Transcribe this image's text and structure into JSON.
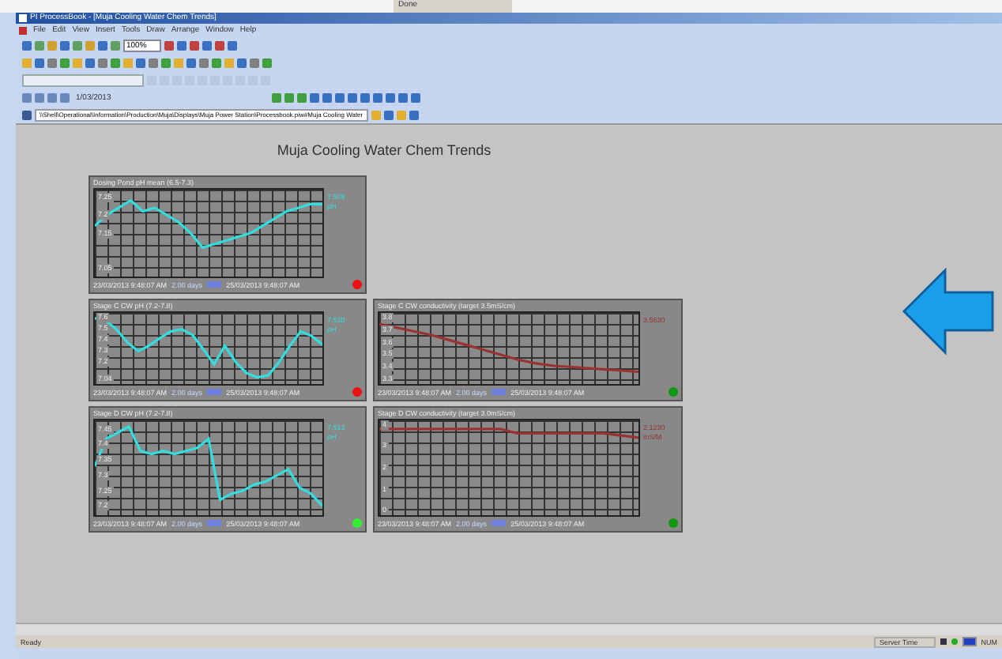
{
  "top_strip": {
    "text": "Done"
  },
  "window": {
    "title": "PI ProcessBook - [Muja Cooling Water Chem Trends]"
  },
  "menu": [
    "File",
    "Edit",
    "View",
    "Insert",
    "Tools",
    "Draw",
    "Arrange",
    "Window",
    "Help"
  ],
  "toolbar": {
    "zoom": "100%",
    "time": "1/03/2013"
  },
  "address": "\\\\Shell\\Operational\\Information\\Production\\Muja\\Displays\\Muja Power Station\\Processbook.piw#Muja Cooling Water",
  "page_title": "Muja Cooling Water Chem Trends",
  "trend_rows": [
    [
      {
        "title": "Dosing Pond pH mean (6.5-7.3)",
        "color": "#ee1111",
        "legend_value": "7.509",
        "legend_unit": "pH",
        "start_time": "23/03/2013 9:48:07 AM",
        "duration": "2.00 days",
        "end_time": "25/03/2013 9:48:07 AM",
        "chart_data": {
          "type": "line",
          "ylim": [
            7.03,
            7.27
          ],
          "yticks": [
            7.05,
            7.15,
            7.2,
            7.25
          ],
          "series": [
            {
              "color": "#33dddd",
              "values": [
                7.17,
                7.2,
                7.22,
                7.24,
                7.21,
                7.22,
                7.2,
                7.18,
                7.15,
                7.11,
                7.12,
                7.13,
                7.14,
                7.15,
                7.17,
                7.19,
                7.21,
                7.22,
                7.23,
                7.23
              ]
            }
          ]
        }
      }
    ],
    [
      {
        "title": "Stage C CW pH (7.2-7.8)",
        "color": "#ee1111",
        "legend_value": "7.530",
        "legend_unit": "pH",
        "start_time": "23/03/2013 9:48:07 AM",
        "duration": "2.00 days",
        "end_time": "25/03/2013 9:48:07 AM",
        "chart_data": {
          "type": "line",
          "ylim": [
            7.0,
            7.65
          ],
          "yticks": [
            7.04,
            7.2,
            7.3,
            7.4,
            7.5,
            7.6
          ],
          "series": [
            {
              "color": "#33dddd",
              "values": [
                7.6,
                7.58,
                7.5,
                7.38,
                7.3,
                7.35,
                7.42,
                7.48,
                7.5,
                7.45,
                7.32,
                7.18,
                7.35,
                7.2,
                7.1,
                7.06,
                7.08,
                7.2,
                7.35,
                7.48,
                7.44,
                7.36
              ]
            }
          ]
        }
      },
      {
        "title": "Stage C CW conductivity (target 3.5mS/cm)",
        "color": "#119911",
        "legend_value": "3.5630",
        "start_time": "23/03/2013 9:48:07 AM",
        "duration": "2.00 days",
        "end_time": "25/03/2013 9:48:07 AM",
        "chart_data": {
          "type": "line",
          "ylim": [
            3.26,
            3.84
          ],
          "yticks": [
            3.3,
            3.4,
            3.5,
            3.6,
            3.7,
            3.8
          ],
          "series": [
            {
              "color": "#993333",
              "values": [
                3.75,
                3.72,
                3.69,
                3.66,
                3.62,
                3.58,
                3.54,
                3.5,
                3.46,
                3.43,
                3.41,
                3.4,
                3.39,
                3.38,
                3.37,
                3.36
              ]
            }
          ]
        }
      }
    ],
    [
      {
        "title": "Stage D CW pH (7.2-7.8)",
        "color": "#33ee33",
        "legend_value": "7.513",
        "legend_unit": "pH",
        "start_time": "23/03/2013 9:48:07 AM",
        "duration": "2.00 days",
        "end_time": "25/03/2013 9:48:07 AM",
        "chart_data": {
          "type": "line",
          "ylim": [
            7.17,
            7.48
          ],
          "yticks": [
            7.2,
            7.25,
            7.3,
            7.35,
            7.4,
            7.45
          ],
          "series": [
            {
              "color": "#33dddd",
              "values": [
                7.33,
                7.42,
                7.44,
                7.46,
                7.38,
                7.37,
                7.38,
                7.37,
                7.38,
                7.39,
                7.42,
                7.22,
                7.24,
                7.25,
                7.27,
                7.28,
                7.3,
                7.32,
                7.26,
                7.24,
                7.2
              ]
            }
          ]
        }
      },
      {
        "title": "Stage D CW conductivity (target 3.0mS/cm)",
        "color": "#119911",
        "legend_value": "2.1230",
        "legend_unit": "mS/M",
        "start_time": "23/03/2013 9:48:07 AM",
        "duration": "2.00 days",
        "end_time": "25/03/2013 9:48:07 AM",
        "chart_data": {
          "type": "line",
          "ylim": [
            -0.2,
            4.2
          ],
          "yticks": [
            0,
            1,
            2,
            3,
            4
          ],
          "series": [
            {
              "color": "#993333",
              "values": [
                3.8,
                3.8,
                3.8,
                3.8,
                3.8,
                3.8,
                3.8,
                3.8,
                3.6,
                3.6,
                3.6,
                3.6,
                3.6,
                3.6,
                3.5,
                3.4
              ]
            }
          ]
        }
      }
    ]
  ],
  "status_bar": {
    "left": "Ready",
    "server_time": "Server Time",
    "num": "NUM"
  }
}
